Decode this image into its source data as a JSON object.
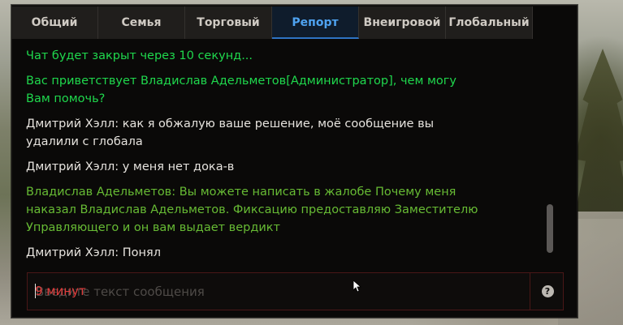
{
  "tabs": [
    {
      "label": "Общий",
      "active": false
    },
    {
      "label": "Семья",
      "active": false
    },
    {
      "label": "Торговый",
      "active": false
    },
    {
      "label": "Репорт",
      "active": true
    },
    {
      "label": "Внеигровой",
      "active": false
    },
    {
      "label": "Глобальный",
      "active": false
    }
  ],
  "messages": [
    {
      "type": "system",
      "text": "Чат будет закрыт через 10 секунд..."
    },
    {
      "type": "system",
      "text": "Вас приветствует Владислав Адельметов[Администратор], чем могу Вам помочь?"
    },
    {
      "type": "player",
      "text": "Дмитрий Хэлл: как я обжалую ваше решение, моё сообщение вы удалили с глобала"
    },
    {
      "type": "player",
      "text": "Дмитрий Хэлл: у меня нет дока-в"
    },
    {
      "type": "admin",
      "text": "Владислав Адельметов: Вы можете написать в жалобе Почему меня наказал Владислав Адельметов. Фиксацию предоставляю Заместителю Управляющего и он вам выдает вердикт"
    },
    {
      "type": "player",
      "text": "Дмитрий Хэлл: Понял"
    }
  ],
  "input": {
    "value": "",
    "placeholder": "Введите текст сообщения",
    "timer_text": "9 минут"
  },
  "help_button": {
    "icon": "question-icon",
    "label": "?"
  },
  "colors": {
    "system": "#1fd84d",
    "admin": "#67bb34",
    "player": "#e6e3de",
    "active_tab": "#4fa3f1",
    "timer": "#e03c3c"
  }
}
